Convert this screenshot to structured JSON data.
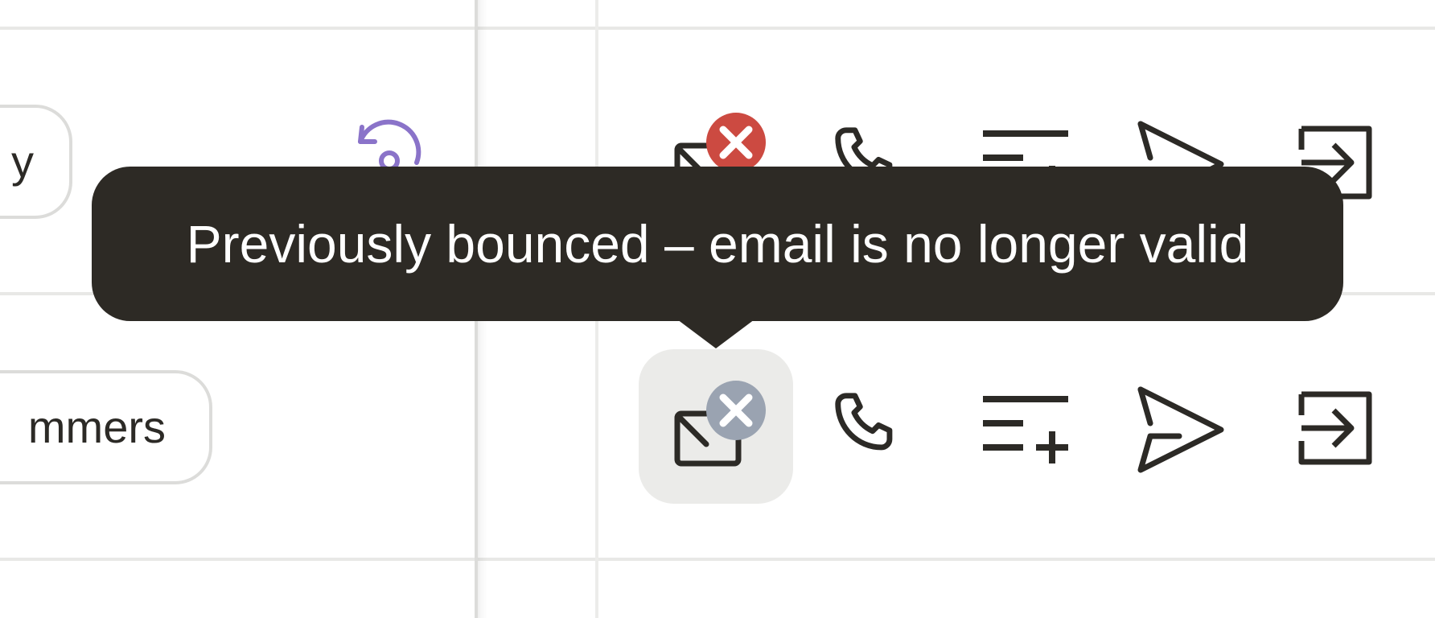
{
  "rows": [
    {
      "segment_label": "y",
      "email_status": "bounced",
      "actions": [
        "mail-icon",
        "phone-icon",
        "add-to-list-icon",
        "send-icon",
        "sign-in-icon"
      ]
    },
    {
      "segment_label": "mmers",
      "email_status": "bounced",
      "actions": [
        "mail-icon",
        "phone-icon",
        "add-to-list-icon",
        "send-icon",
        "sign-in-icon"
      ]
    }
  ],
  "tooltip": {
    "text": "Previously bounced – email is no longer valid"
  },
  "colors": {
    "tooltip_bg": "#2d2a25",
    "bounce_badge_active": "#cc4a41",
    "bounce_badge_muted": "#9aa3b1",
    "accent_purple": "#8a73c9",
    "icon_stroke": "#2c2a26"
  }
}
